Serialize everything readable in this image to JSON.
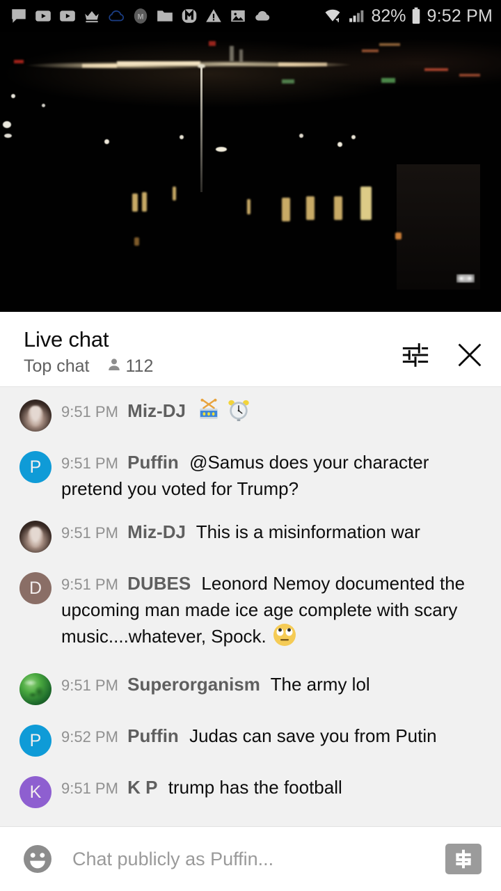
{
  "statusbar": {
    "icons": [
      {
        "name": "messenger-chat-icon"
      },
      {
        "name": "youtube-icon"
      },
      {
        "name": "youtube-icon"
      },
      {
        "name": "crown-icon"
      },
      {
        "name": "cloud-outline-icon"
      },
      {
        "name": "circle-m-icon"
      },
      {
        "name": "folder-icon"
      },
      {
        "name": "m-badge-icon"
      },
      {
        "name": "warning-triangle-icon"
      },
      {
        "name": "image-icon"
      },
      {
        "name": "cloud-filled-icon"
      }
    ],
    "wifi_icon": "wifi-icon",
    "signal_icon": "cellular-signal-icon",
    "battery_percent": "82%",
    "battery_icon": "battery-icon",
    "clock": "9:52 PM"
  },
  "video": {
    "name": "live-stream-video",
    "progress_color": "#e62117",
    "progress_percent": 100
  },
  "chat_header": {
    "title": "Live chat",
    "mode_label": "Top chat",
    "viewer_icon": "person-icon",
    "viewer_count": "112",
    "settings_icon": "tune-sliders-icon",
    "close_icon": "close-icon"
  },
  "messages": [
    {
      "avatar_kind": "bear",
      "avatar_letter": "",
      "avatar_color": "#4a3a33",
      "time": "9:51 PM",
      "author": "Miz-DJ",
      "text": "",
      "emojis": [
        "drum",
        "alarm-clock"
      ]
    },
    {
      "avatar_kind": "letter",
      "avatar_letter": "P",
      "avatar_color": "#0f9bd7",
      "time": "9:51 PM",
      "author": "Puffin",
      "text": "@Samus does your character pretend you voted for Trump?",
      "emojis": []
    },
    {
      "avatar_kind": "bear",
      "avatar_letter": "",
      "avatar_color": "#4a3a33",
      "time": "9:51 PM",
      "author": "Miz-DJ",
      "text": "This is a misinformation war",
      "emojis": []
    },
    {
      "avatar_kind": "letter",
      "avatar_letter": "D",
      "avatar_color": "#8a6e66",
      "time": "9:51 PM",
      "author": "DUBES",
      "text": "Leonord Nemoy documented the upcoming man made ice age complete with scary music....whatever, Spock.",
      "emojis": [
        "rolling-eyes"
      ]
    },
    {
      "avatar_kind": "globe",
      "avatar_letter": "",
      "avatar_color": "#2f8a3c",
      "time": "9:51 PM",
      "author": "Superorganism",
      "text": "The army lol",
      "emojis": []
    },
    {
      "avatar_kind": "letter",
      "avatar_letter": "P",
      "avatar_color": "#0f9bd7",
      "time": "9:52 PM",
      "author": "Puffin",
      "text": "Judas can save you from Putin",
      "emojis": []
    },
    {
      "avatar_kind": "letter",
      "avatar_letter": "K",
      "avatar_color": "#8e5fd0",
      "time": "9:51 PM",
      "author": "K P",
      "text": "trump has the football",
      "emojis": []
    }
  ],
  "composer": {
    "emoji_icon": "emoji-smiley-icon",
    "placeholder": "Chat publicly as Puffin...",
    "value": "",
    "superchat_icon": "dollar-superchat-icon"
  }
}
